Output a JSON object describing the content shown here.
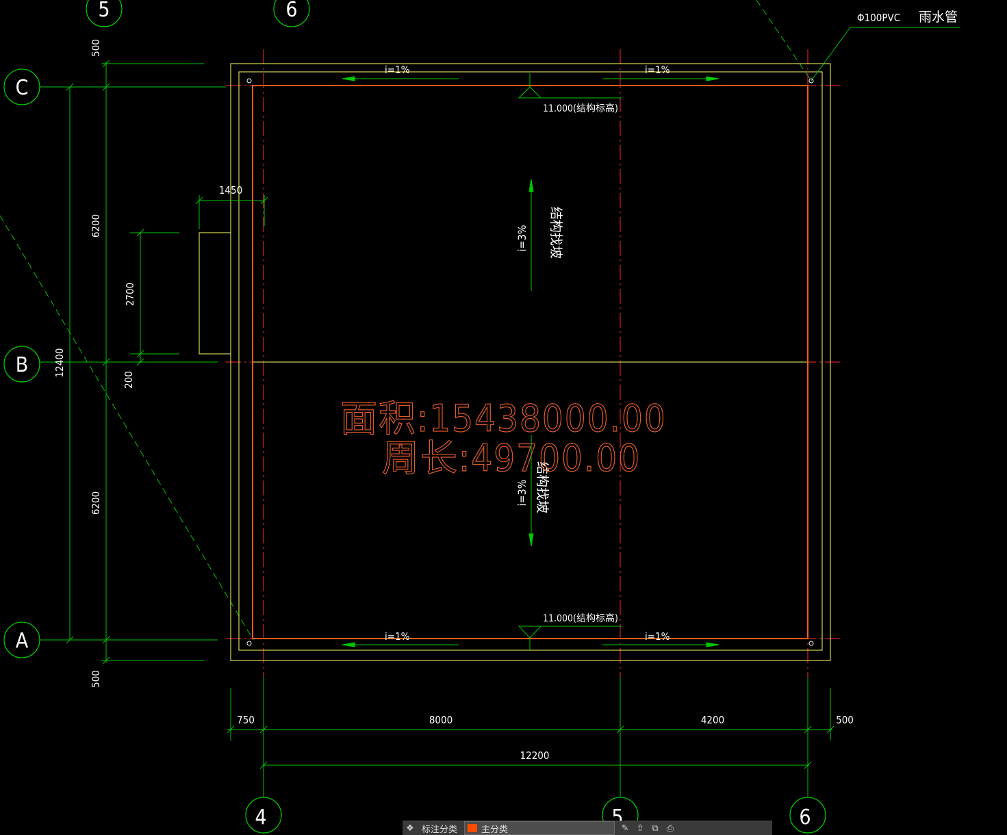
{
  "axes": {
    "columns": [
      "5",
      "6",
      "4",
      "5",
      "6"
    ],
    "rows": [
      "C",
      "B",
      "A"
    ]
  },
  "labels": {
    "drain_pipe": "Φ100PVC",
    "drain_pipe_cn": "雨水管",
    "slope_1": "i=1%",
    "slope_3": "i=3%",
    "slope_note": "结构找坡",
    "elevation": "11.000(结构标高)",
    "area": "面积:15438000.00",
    "perimeter": "周长:49700.00"
  },
  "dimensions": {
    "left_top": "500",
    "left_upper": "6200",
    "left_total": "12400",
    "left_opening": "2700",
    "left_mid": "200",
    "left_lower": "6200",
    "left_bottom": "500",
    "opening_width": "1450",
    "bottom_750": "750",
    "bottom_8000": "8000",
    "bottom_4200": "4200",
    "bottom_500": "500",
    "bottom_total": "12200"
  },
  "colors": {
    "grid": "#00c800",
    "axis_line": "#ff2a2a",
    "outline": "#ffff66",
    "slab": "#ff5a14",
    "text": "#ffffff",
    "measure": "#e05a28"
  },
  "toolbar": {
    "item1": "标注分类",
    "layer": "主分类",
    "layer_color": "#ff4a00"
  }
}
